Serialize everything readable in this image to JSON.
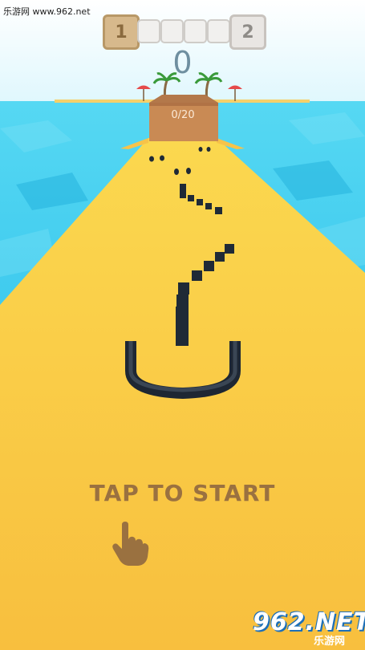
{
  "watermark": {
    "top_left": "乐游网 www.962.net",
    "logo_main": "962.NET",
    "logo_sub": "乐游网"
  },
  "progress": {
    "current_level": "1",
    "next_level": "2",
    "segments_total": 5,
    "segments_filled": 0
  },
  "score": "0",
  "collector_counter": "0/20",
  "prompt": {
    "start_text": "TAP TO START",
    "hand_icon": "pointing-hand-icon"
  },
  "colors": {
    "sky": "#e9fbff",
    "sea": "#2fc7ee",
    "track": "#fbd14a",
    "track_edge": "#f6b53f",
    "blocks": "#1f2a36",
    "crate": "#c98a54",
    "prompt_text": "#9a7140"
  }
}
